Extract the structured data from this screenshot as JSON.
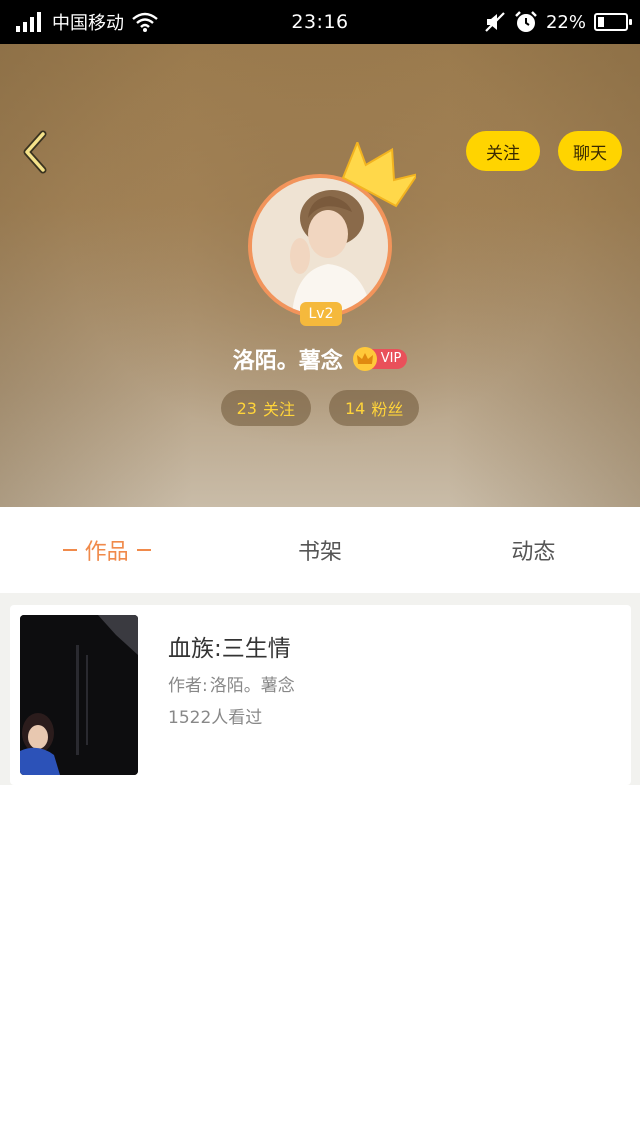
{
  "status_bar": {
    "carrier": "中国移动",
    "time": "23:16",
    "battery_percent": "22%",
    "battery_level": 0.22
  },
  "profile": {
    "follow_label": "关注",
    "chat_label": "聊天",
    "level": "Lv2",
    "username": "洛陌。薯念",
    "vip_label": "VIP",
    "following_count": "23",
    "following_label": "关注",
    "followers_count": "14",
    "followers_label": "粉丝"
  },
  "tabs": [
    {
      "label": "作品",
      "active": true
    },
    {
      "label": "书架",
      "active": false
    },
    {
      "label": "动态",
      "active": false
    }
  ],
  "works": [
    {
      "title": "血族:三生情",
      "author_prefix": "作者:",
      "author": "洛陌。薯念",
      "views": "1522人看过"
    }
  ],
  "colors": {
    "accent": "#f08a4b",
    "button_yellow": "#ffd400",
    "stat_text": "#ffd43a",
    "vip_red": "#e9505a"
  },
  "icons": [
    "signal-icon",
    "wifi-icon",
    "mute-icon",
    "alarm-icon",
    "battery-icon",
    "back-arrow-icon",
    "crown-icon",
    "vip-crown-icon"
  ]
}
